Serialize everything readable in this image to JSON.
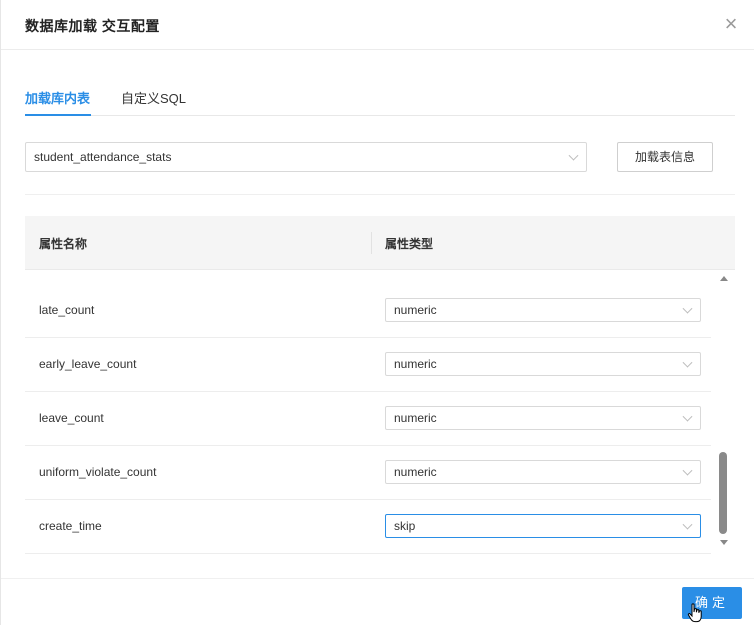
{
  "dialog": {
    "title": "数据库加载 交互配置",
    "close_glyph": "×"
  },
  "tabs": [
    {
      "label": "加载库内表",
      "active": true
    },
    {
      "label": "自定义SQL",
      "active": false
    }
  ],
  "table_select": {
    "value": "student_attendance_stats"
  },
  "load_button": {
    "label": "加载表信息"
  },
  "table": {
    "columns": [
      "属性名称",
      "属性类型"
    ],
    "rows": [
      {
        "name": "late_count",
        "type": "numeric"
      },
      {
        "name": "early_leave_count",
        "type": "numeric"
      },
      {
        "name": "leave_count",
        "type": "numeric"
      },
      {
        "name": "uniform_violate_count",
        "type": "numeric"
      },
      {
        "name": "create_time",
        "type": "skip"
      }
    ]
  },
  "footer": {
    "ok_label": "确定"
  },
  "colors": {
    "accent": "#2a8ee6"
  }
}
